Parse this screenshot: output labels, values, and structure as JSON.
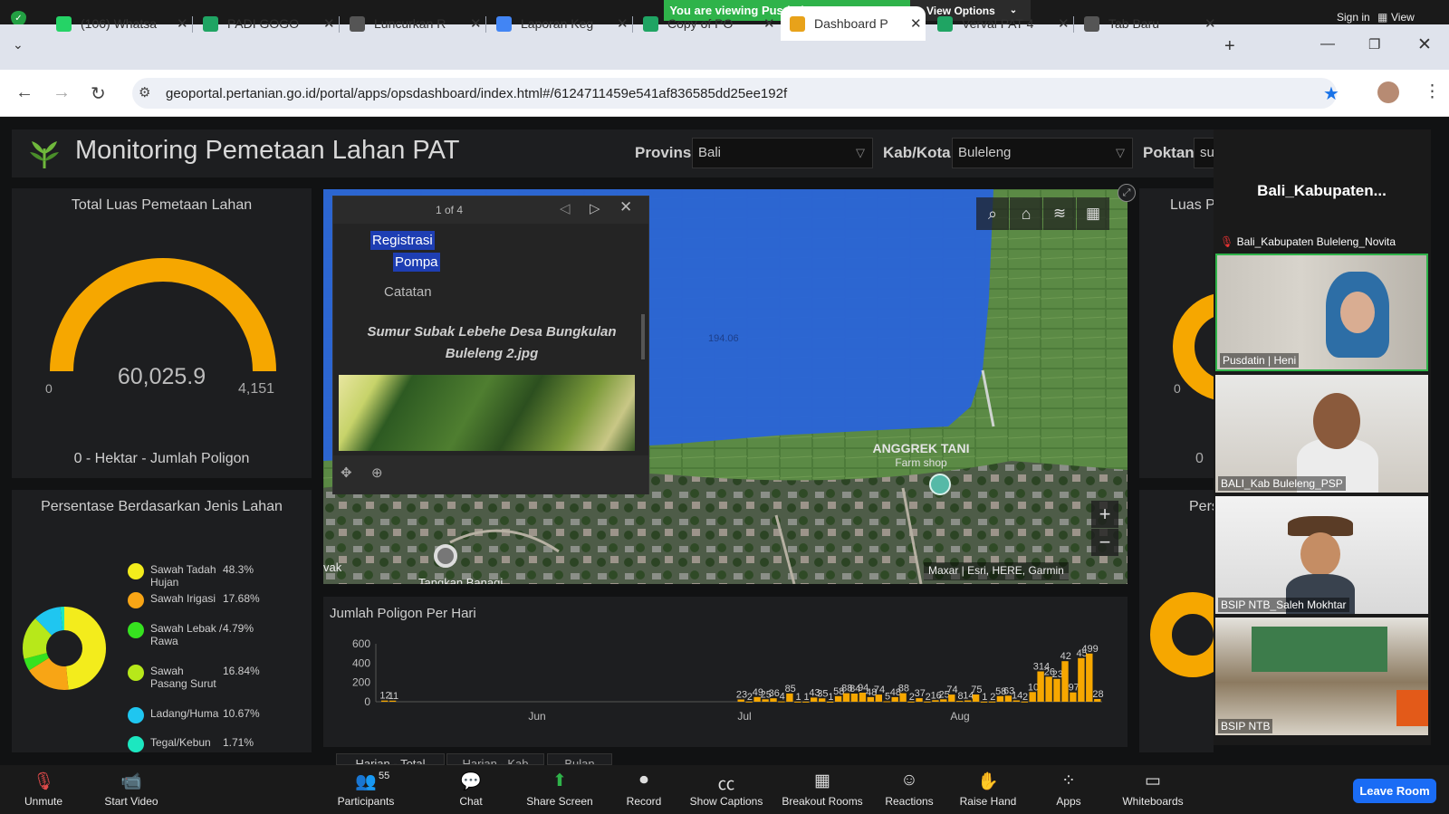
{
  "zoom": {
    "banner": "You are viewing Pusdatin_Hanny's screen",
    "view_options": "View Options",
    "sign_in": "Sign in",
    "view": "View",
    "toolbar": [
      {
        "label": "Unmute",
        "icon": "mic-muted-icon"
      },
      {
        "label": "Start Video",
        "icon": "video-off-icon"
      },
      {
        "label": "Participants",
        "icon": "participants-icon",
        "count": "55"
      },
      {
        "label": "Chat",
        "icon": "chat-icon"
      },
      {
        "label": "Share Screen",
        "icon": "share-screen-icon"
      },
      {
        "label": "Record",
        "icon": "record-icon"
      },
      {
        "label": "Show Captions",
        "icon": "captions-icon"
      },
      {
        "label": "Breakout Rooms",
        "icon": "breakout-icon"
      },
      {
        "label": "Reactions",
        "icon": "reactions-icon"
      },
      {
        "label": "Raise Hand",
        "icon": "raise-hand-icon"
      },
      {
        "label": "Apps",
        "icon": "apps-icon"
      },
      {
        "label": "Whiteboards",
        "icon": "whiteboard-icon"
      }
    ],
    "leave": "Leave Room",
    "gallery_title": "Bali_Kabupaten...",
    "participants": [
      {
        "name": "Bali_Kabupaten Buleleng_Novita",
        "label_only": true
      },
      {
        "name": "Pusdatin | Heni"
      },
      {
        "name": "BALI_Kab Buleleng_PSP"
      },
      {
        "name": "BSIP NTB_Saleh Mokhtar"
      },
      {
        "name": "BSIP NTB"
      }
    ]
  },
  "browser": {
    "tabs": [
      {
        "title": "(106) Whatsa",
        "icon_color": "#25d366"
      },
      {
        "title": "PADI GOGO",
        "icon_color": "#1fa463"
      },
      {
        "title": "Luncurkan R",
        "icon_color": "#555"
      },
      {
        "title": "Laporan Keg",
        "icon_color": "#4285f4"
      },
      {
        "title": "Copy of PO",
        "icon_color": "#1fa463"
      },
      {
        "title": "Dashboard P",
        "icon_color": "#e8a21a"
      },
      {
        "title": "Verval PAT 4",
        "icon_color": "#1fa463"
      },
      {
        "title": "Tab Baru",
        "icon_color": "#555"
      }
    ],
    "url": "geoportal.pertanian.go.id/portal/apps/opsdashboard/index.html#/6124711459e541af836585dd25ee192f"
  },
  "dashboard": {
    "title": "Monitoring Pemetaan Lahan PAT",
    "filters": {
      "provinsi_label": "Provinsi",
      "provinsi_value": "Bali",
      "kab_label": "Kab/Kota",
      "kab_value": "Buleleng",
      "poktan_label": "Poktan",
      "poktan_value": "su"
    },
    "gauge": {
      "title": "Total Luas Pemetaan Lahan",
      "value": "60,025.9",
      "min": "0",
      "max": "4,151",
      "subtitle": "0 - Hektar - Jumlah Poligon",
      "fill": 1.0
    },
    "right_gauge": {
      "title": "Luas P",
      "min": "0",
      "zero": "0"
    },
    "pie": {
      "title": "Persentase Berdasarkan Jenis Lahan",
      "right_title": "Persen",
      "items": [
        {
          "name": "Sawah Tadah Hujan",
          "pct": "48.3%",
          "value": 48.3,
          "color": "#f3ec1c"
        },
        {
          "name": "Sawah Irigasi",
          "pct": "17.68%",
          "value": 17.68,
          "color": "#f8a515"
        },
        {
          "name": "Sawah Lebak / Rawa",
          "pct": "4.79%",
          "value": 4.79,
          "color": "#36e21f"
        },
        {
          "name": "Sawah Pasang Surut",
          "pct": "16.84%",
          "value": 16.84,
          "color": "#b7e81a"
        },
        {
          "name": "Ladang/Huma",
          "pct": "10.67%",
          "value": 10.67,
          "color": "#1fc6f0"
        },
        {
          "name": "Tegal/Kebun",
          "pct": "1.71%",
          "value": 1.71,
          "color": "#1ce7c0"
        }
      ]
    },
    "popup": {
      "pager": "1 of 4",
      "field1": "Registrasi",
      "field2": "Pompa",
      "catatan": "Catatan",
      "caption": "Sumur Subak Lebehe Desa Bungkulan Buleleng 2.jpg"
    },
    "map": {
      "place": "ANGGREK TANI",
      "place_sub": "Farm shop",
      "attribution": "Maxar | Esri, HERE, Garmin",
      "parcel_label": "194.06",
      "road": "Tangkan Banagi",
      "corner": "vak"
    },
    "chart_tabs": [
      "Harian - Total",
      "Harian - Kab",
      "Bulan"
    ]
  },
  "chart_data": {
    "type": "bar",
    "title": "Jumlah Poligon Per Hari",
    "ylim": [
      0,
      600
    ],
    "yticks": [
      "600",
      "400",
      "200",
      "0"
    ],
    "month_labels": [
      "Jun",
      "Jul",
      "Aug"
    ],
    "color": "#f6a700",
    "values": [
      12,
      11,
      0,
      0,
      0,
      0,
      0,
      0,
      0,
      0,
      0,
      0,
      0,
      0,
      0,
      0,
      0,
      0,
      0,
      0,
      0,
      0,
      0,
      0,
      0,
      0,
      0,
      0,
      0,
      0,
      0,
      0,
      0,
      0,
      0,
      0,
      0,
      0,
      0,
      0,
      0,
      0,
      0,
      0,
      23,
      2,
      49,
      25,
      36,
      4,
      85,
      1,
      1,
      43,
      35,
      1,
      58,
      88,
      84,
      94,
      48,
      74,
      5,
      48,
      88,
      2,
      37,
      2,
      16,
      25,
      74,
      8,
      14,
      75,
      1,
      2,
      58,
      63,
      14,
      2,
      100,
      314,
      260,
      236,
      420,
      97,
      452,
      499,
      28
    ],
    "bar_labels": [
      "12",
      "11",
      "23",
      "2",
      "49",
      "25",
      "36",
      "4",
      "85",
      "1",
      "1",
      "43",
      "35",
      "1",
      "58",
      "88",
      "84",
      "94",
      "48",
      "74",
      "5",
      "48",
      "88",
      "2",
      "37",
      "2",
      "16",
      "25",
      "74",
      "8",
      "14",
      "75",
      "1",
      "2",
      "58",
      "63",
      "14",
      "2",
      "10",
      "314",
      "26",
      "23",
      "42",
      "97",
      "45",
      "499",
      "28"
    ]
  }
}
